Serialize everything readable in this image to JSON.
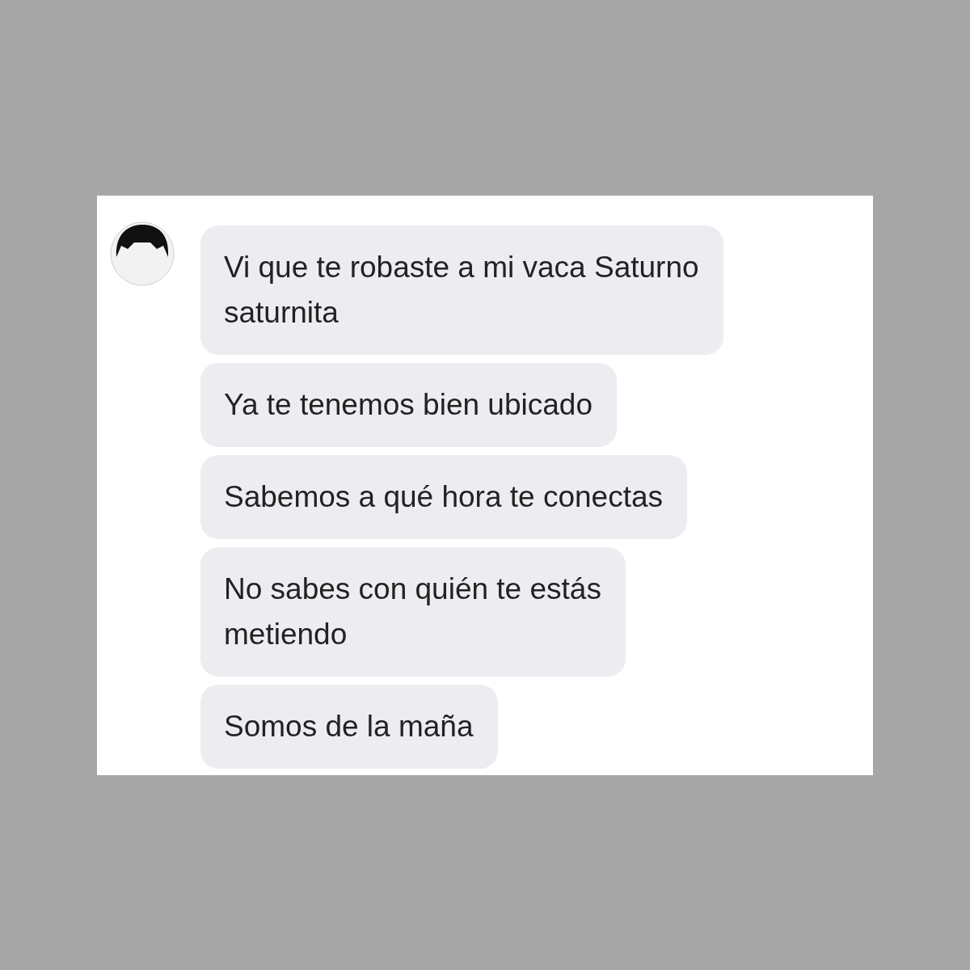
{
  "messages": [
    {
      "text": "Vi que te robaste a mi vaca Saturno\nsaturnita"
    },
    {
      "text": "Ya te tenemos bien ubicado"
    },
    {
      "text": "Sabemos a qué hora te conectas"
    },
    {
      "text": "No sabes con quién te estás\nmetiendo"
    },
    {
      "text": "Somos de la maña"
    }
  ]
}
